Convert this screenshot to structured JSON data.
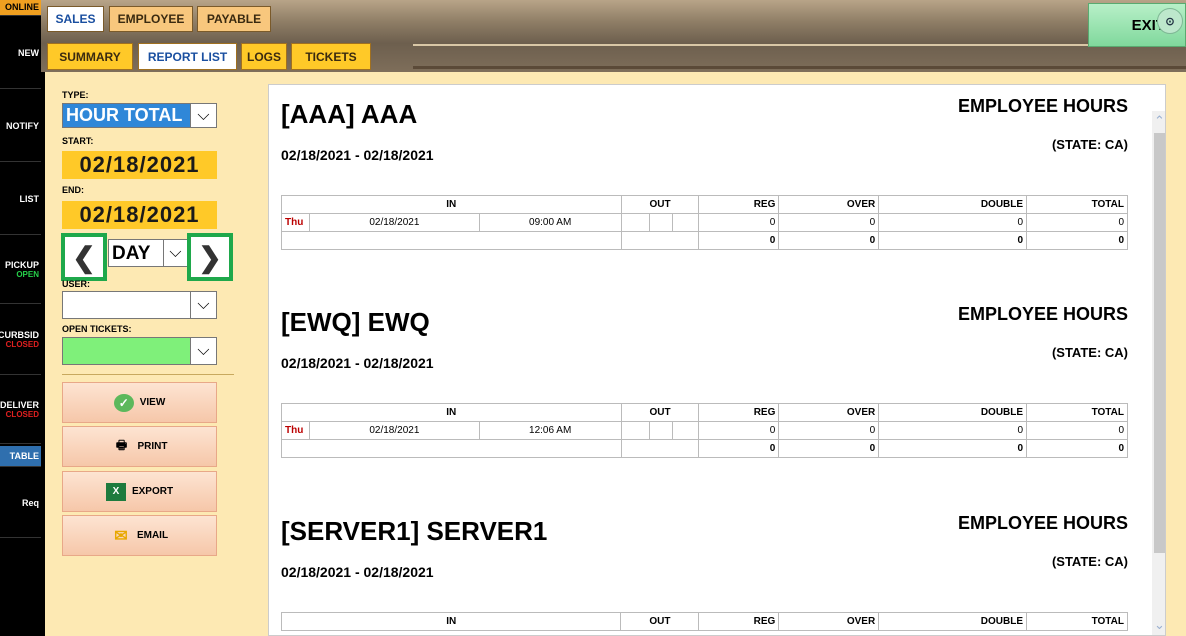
{
  "sidebar": {
    "online": "ONLINE",
    "items": [
      {
        "label": "NEW",
        "sub": ""
      },
      {
        "label": "NOTIFY",
        "sub": ""
      },
      {
        "label": "LIST",
        "sub": ""
      },
      {
        "label": "PICKUP",
        "sub": "OPEN"
      },
      {
        "label": "CURBSID",
        "sub": "CLOSED"
      },
      {
        "label": "DELIVER",
        "sub": "CLOSED"
      },
      {
        "label": "TABLE",
        "sub": ""
      },
      {
        "label": "Req",
        "sub": ""
      }
    ]
  },
  "tabs": {
    "main": [
      "SALES",
      "EMPLOYEE",
      "PAYABLE"
    ],
    "sub": [
      "SUMMARY",
      "REPORT LIST",
      "LOGS",
      "TICKETS"
    ]
  },
  "exit_label": "EXIT",
  "controls": {
    "type_label": "TYPE:",
    "type_value": "HOUR TOTAL",
    "start_label": "START:",
    "start_date": "02/18/2021",
    "end_label": "END:",
    "end_date": "02/18/2021",
    "period_value": "DAY",
    "user_label": "USER:",
    "open_tickets_label": "OPEN TICKETS:",
    "buttons": {
      "view": "VIEW",
      "print": "PRINT",
      "export": "EXPORT",
      "email": "EMAIL"
    }
  },
  "report": {
    "columns": [
      "IN",
      "OUT",
      "REG",
      "OVER",
      "DOUBLE",
      "TOTAL"
    ],
    "sections": [
      {
        "name": "[AAA] AAA",
        "title": "EMPLOYEE HOURS",
        "state": "(STATE: CA)",
        "range": "02/18/2021 - 02/18/2021",
        "rows": [
          {
            "day": "Thu",
            "date": "02/18/2021",
            "time": "09:00 AM",
            "reg": "0",
            "over": "0",
            "double": "0",
            "total": "0"
          }
        ],
        "totals": {
          "reg": "0",
          "over": "0",
          "double": "0",
          "total": "0"
        }
      },
      {
        "name": "[EWQ] EWQ",
        "title": "EMPLOYEE HOURS",
        "state": "(STATE: CA)",
        "range": "02/18/2021 - 02/18/2021",
        "rows": [
          {
            "day": "Thu",
            "date": "02/18/2021",
            "time": "12:06 AM",
            "reg": "0",
            "over": "0",
            "double": "0",
            "total": "0"
          }
        ],
        "totals": {
          "reg": "0",
          "over": "0",
          "double": "0",
          "total": "0"
        }
      },
      {
        "name": "[SERVER1] SERVER1",
        "title": "EMPLOYEE HOURS",
        "state": "(STATE: CA)",
        "range": "02/18/2021 - 02/18/2021"
      }
    ]
  }
}
